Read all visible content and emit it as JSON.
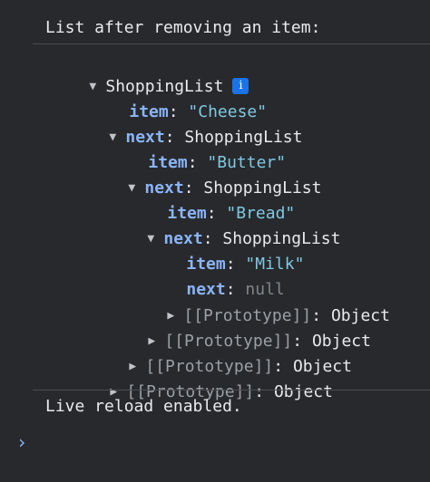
{
  "console": {
    "log_message": "List after removing an item:",
    "live_reload_message": "Live reload enabled.",
    "prompt_symbol": "›"
  },
  "tree": {
    "root_type": "ShoppingList",
    "info_symbol": "i",
    "item_key": "item",
    "next_key": "next",
    "colon": ":",
    "prototype_key": "[[Prototype]]",
    "prototype_value": "Object",
    "null_value": "null",
    "items": [
      "\"Cheese\"",
      "\"Butter\"",
      "\"Bread\"",
      "\"Milk\""
    ],
    "colors": {
      "key": "#8ab4f8",
      "string": "#7ec8e3",
      "null": "#80868b",
      "info_badge": "#1a73e8"
    }
  }
}
